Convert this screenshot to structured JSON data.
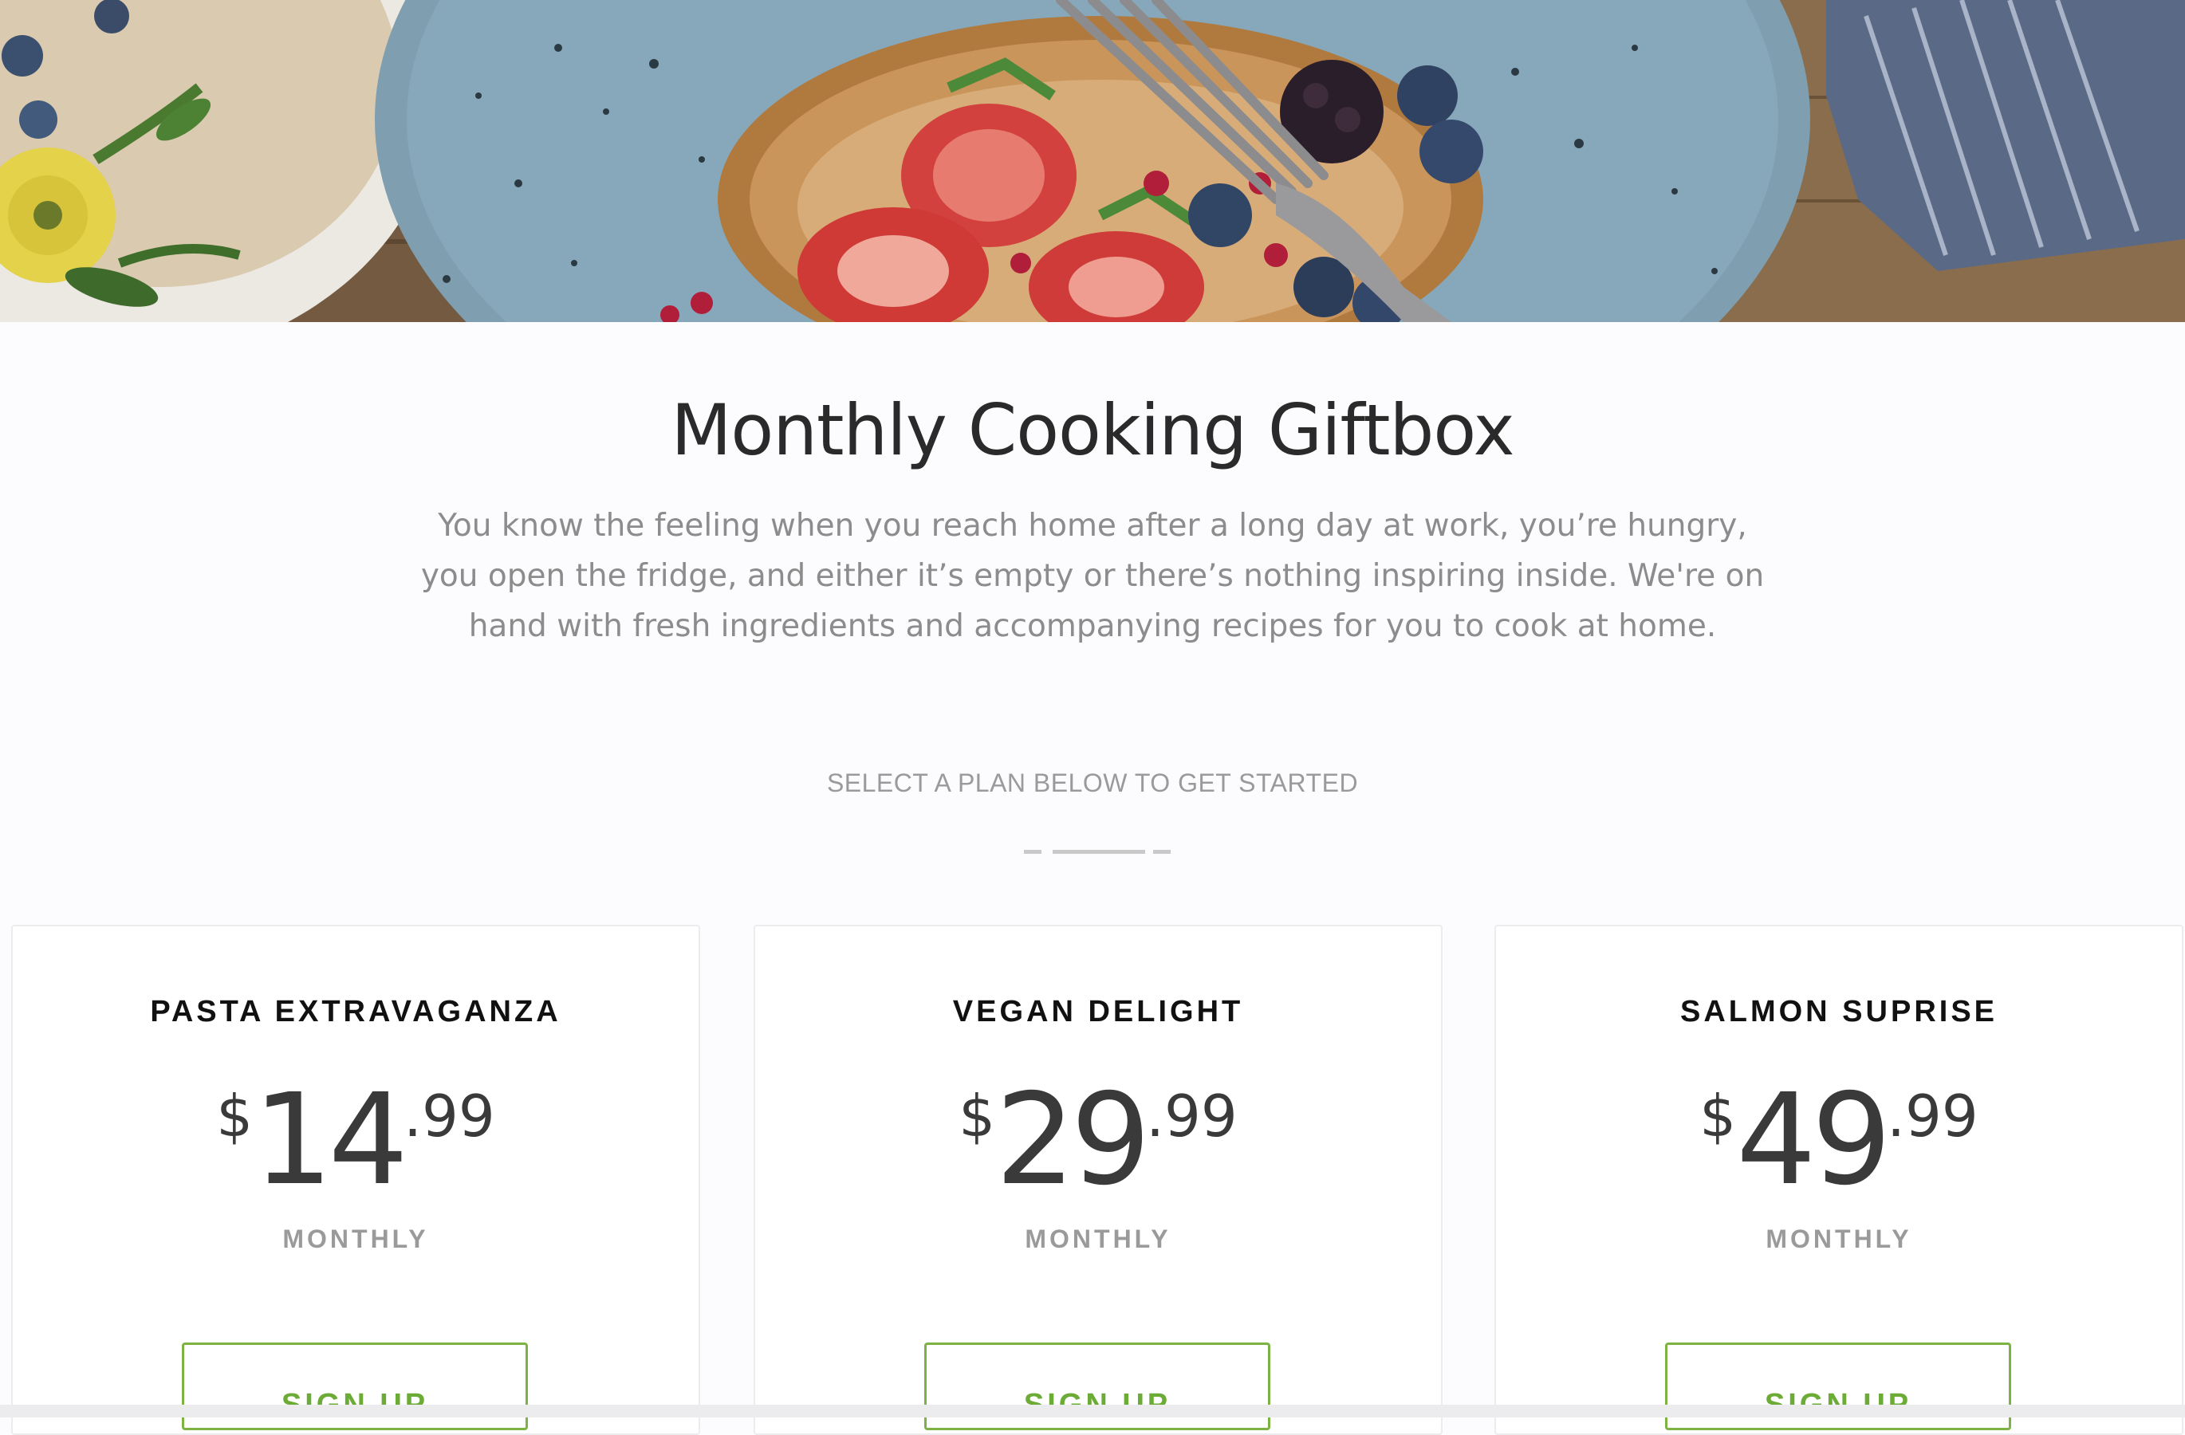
{
  "hero": {
    "image_alt": "food-plate-photo"
  },
  "header": {
    "title": "Monthly Cooking Giftbox",
    "intro": "You know the feeling when you reach home after a long day at work, you’re hungry, you open the fridge, and either it’s empty or there’s nothing inspiring inside. We're on hand with fresh ingredients and accompanying recipes for you to cook at home."
  },
  "plans_section": {
    "heading": "SELECT A PLAN BELOW TO GET STARTED"
  },
  "plans": [
    {
      "name": "PASTA EXTRAVAGANZA",
      "currency": "$",
      "whole": "14",
      "cents": ".99",
      "period": "MONTHLY",
      "button_label": "SIGN UP"
    },
    {
      "name": "VEGAN DELIGHT",
      "currency": "$",
      "whole": "29",
      "cents": ".99",
      "period": "MONTHLY",
      "button_label": "SIGN UP"
    },
    {
      "name": "SALMON SUPRISE",
      "currency": "$",
      "whole": "49",
      "cents": ".99",
      "period": "MONTHLY",
      "button_label": "SIGN UP"
    }
  ],
  "colors": {
    "accent_green": "#7cb342",
    "title_text": "#2a2a2a",
    "muted_text": "#8c8c8c"
  }
}
